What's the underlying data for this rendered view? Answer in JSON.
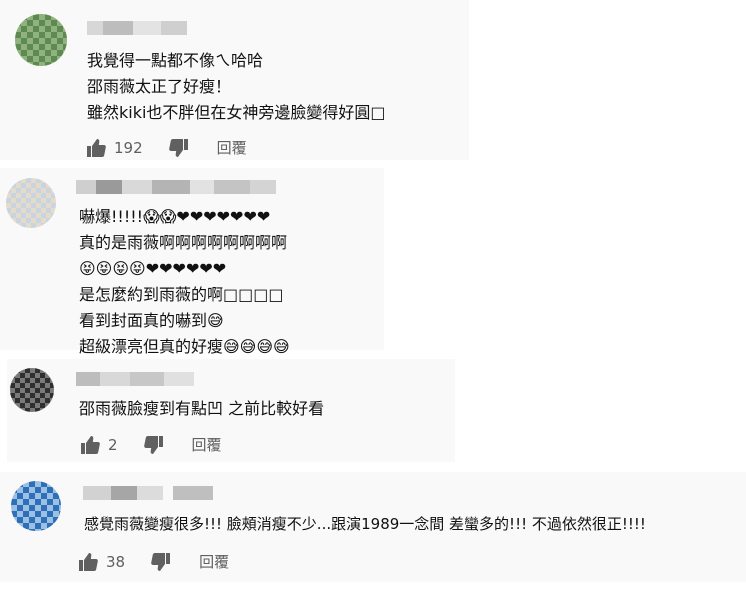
{
  "comments": [
    {
      "lines": [
        "我覺得一點都不像ㄟ哈哈",
        "邵雨薇太正了好瘦！",
        "雖然kiki也不胖但在女神旁邊臉變得好圓□"
      ],
      "likes": "192",
      "reply_label": "回覆"
    },
    {
      "lines": [
        "嚇爆!!!!!😱😱❤❤❤❤❤❤❤",
        "真的是雨薇啊啊啊啊啊啊啊啊",
        "😝😝😝😝❤❤❤❤❤❤",
        "是怎麼約到雨薇的啊□□□□",
        "看到封面真的嚇到😅",
        "超級漂亮但真的好瘦😅😅😅😅"
      ],
      "likes": "",
      "reply_label": ""
    },
    {
      "lines": [
        "邵雨薇臉瘦到有點凹 之前比較好看"
      ],
      "likes": "2",
      "reply_label": "回覆"
    },
    {
      "lines": [
        "感覺雨薇變瘦很多!!! 臉頰消瘦不少...跟演1989一念間 差蠻多的!!! 不過依然很正!!!!"
      ],
      "likes": "38",
      "reply_label": "回覆"
    }
  ],
  "icons": [
    "thumb-up-icon",
    "thumb-down-icon"
  ],
  "colors": {
    "card_bg": "#f9f9f9",
    "meta_text": "#606060",
    "heart": "#cc1f2b"
  }
}
